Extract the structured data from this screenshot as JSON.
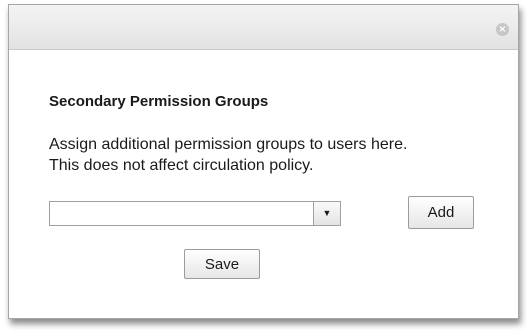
{
  "dialog": {
    "close_glyph": "×",
    "heading": "Secondary Permission Groups",
    "description_lines": [
      "Assign additional permission groups to users here.",
      "This does not affect circulation policy."
    ],
    "group_select": {
      "selected_value": "",
      "arrow_glyph": "▼"
    },
    "add_label": "Add",
    "save_label": "Save"
  }
}
